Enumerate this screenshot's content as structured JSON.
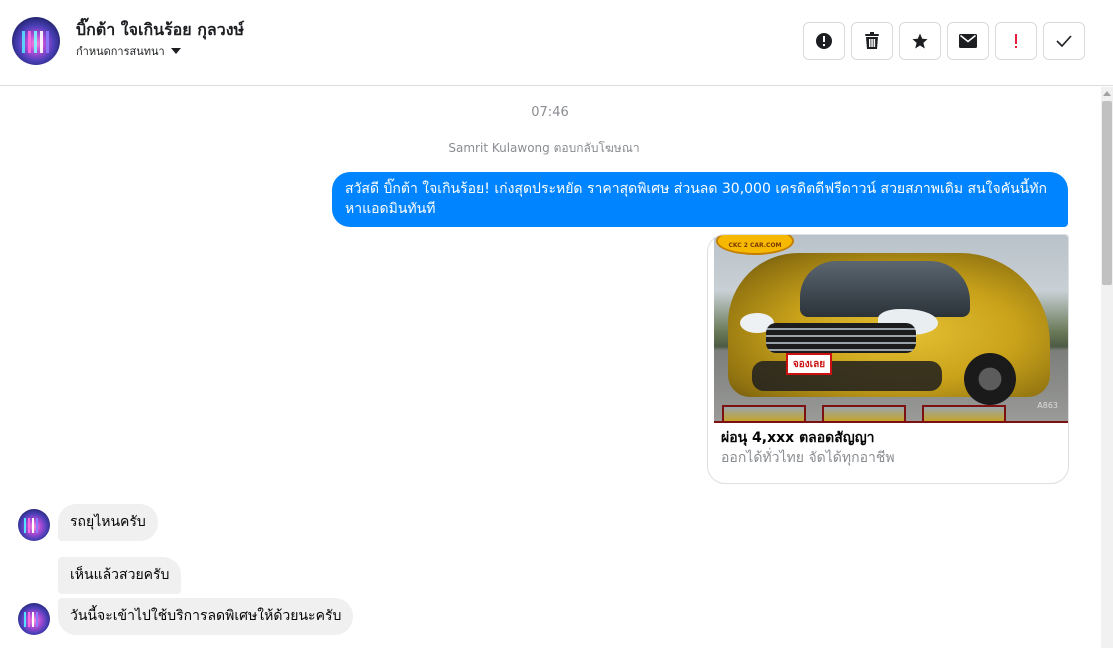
{
  "header": {
    "contact_name": "บิ๊กต้า ใจเกินร้อย กุลวงษ์",
    "subtitle": "กำหนดการสนทนา",
    "toolbar": [
      {
        "name": "spam-report-button",
        "icon": "alert-circle-icon",
        "glyph": "!"
      },
      {
        "name": "delete-button",
        "icon": "trash-icon",
        "glyph": ""
      },
      {
        "name": "star-button",
        "icon": "star-icon",
        "glyph": "★"
      },
      {
        "name": "mark-unread-button",
        "icon": "envelope-icon",
        "glyph": ""
      },
      {
        "name": "follow-up-button",
        "icon": "exclamation-icon",
        "glyph": "!"
      },
      {
        "name": "mark-done-button",
        "icon": "check-icon",
        "glyph": "✓"
      }
    ]
  },
  "conversation": {
    "timestamp": "07:46",
    "reply_note": "Samrit Kulawong ตอบกลับโฆษณา",
    "outgoing_message": "สวัสดี บิ๊กต้า ใจเกินร้อย! เก่งสุดประหยัด ราคาสุดพิเศษ ส่วนลด 30,000 เครดิตดีฟรีดาวน์ สวยสภาพเดิม สนใจคันนี้ทักหาแอดมินทันที",
    "ad_card": {
      "image_logo": "CKC 2 CAR.COM",
      "plate_text": "จองเลย",
      "photo_code": "A863",
      "title": "ผ่อนุ 4,xxx ตลอดสัญญา",
      "subtitle": "ออกได้ทั่วไทย จัดได้ทุกอาชีพ"
    },
    "incoming_messages": [
      "รถยุไหนครับ",
      "เห็นแล้วสวยครับ",
      "วันนี้จะเข้าไปใช้บริการลดพิเศษให้ด้วยนะครับ"
    ]
  },
  "colors": {
    "outgoing_bubble": "#0084ff",
    "incoming_bubble": "#f0f0f0",
    "follow_up_accent": "#e41e3f"
  }
}
